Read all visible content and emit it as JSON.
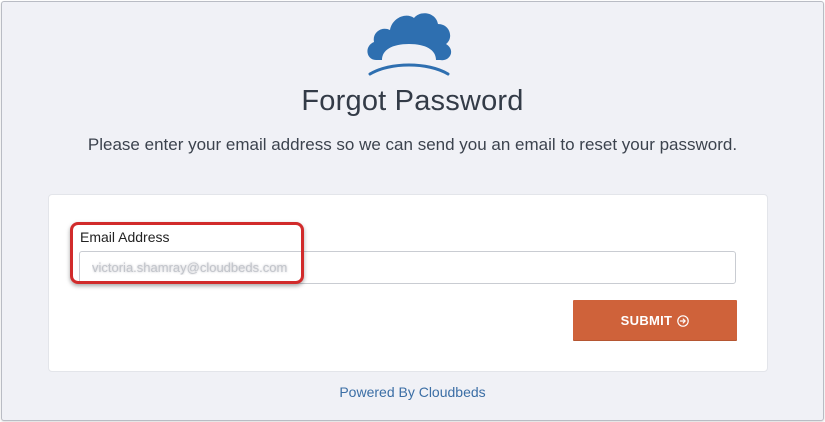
{
  "page": {
    "title": "Forgot Password",
    "subtitle": "Please enter your email address so we can send you an email to reset your password.",
    "accent_color": "#cf623a",
    "brand_color": "#2e6fb0"
  },
  "logo": {
    "icon": "cloudbeds-logo-icon"
  },
  "form": {
    "email_label": "Email Address",
    "email_value": "victoria.shamray@cloudbeds.com",
    "submit_label": "SUBMIT",
    "submit_icon": "arrow-circle-right-icon"
  },
  "annotation": {
    "highlight_color": "#d12b2b"
  },
  "footer": {
    "powered_by": "Powered By Cloudbeds"
  }
}
